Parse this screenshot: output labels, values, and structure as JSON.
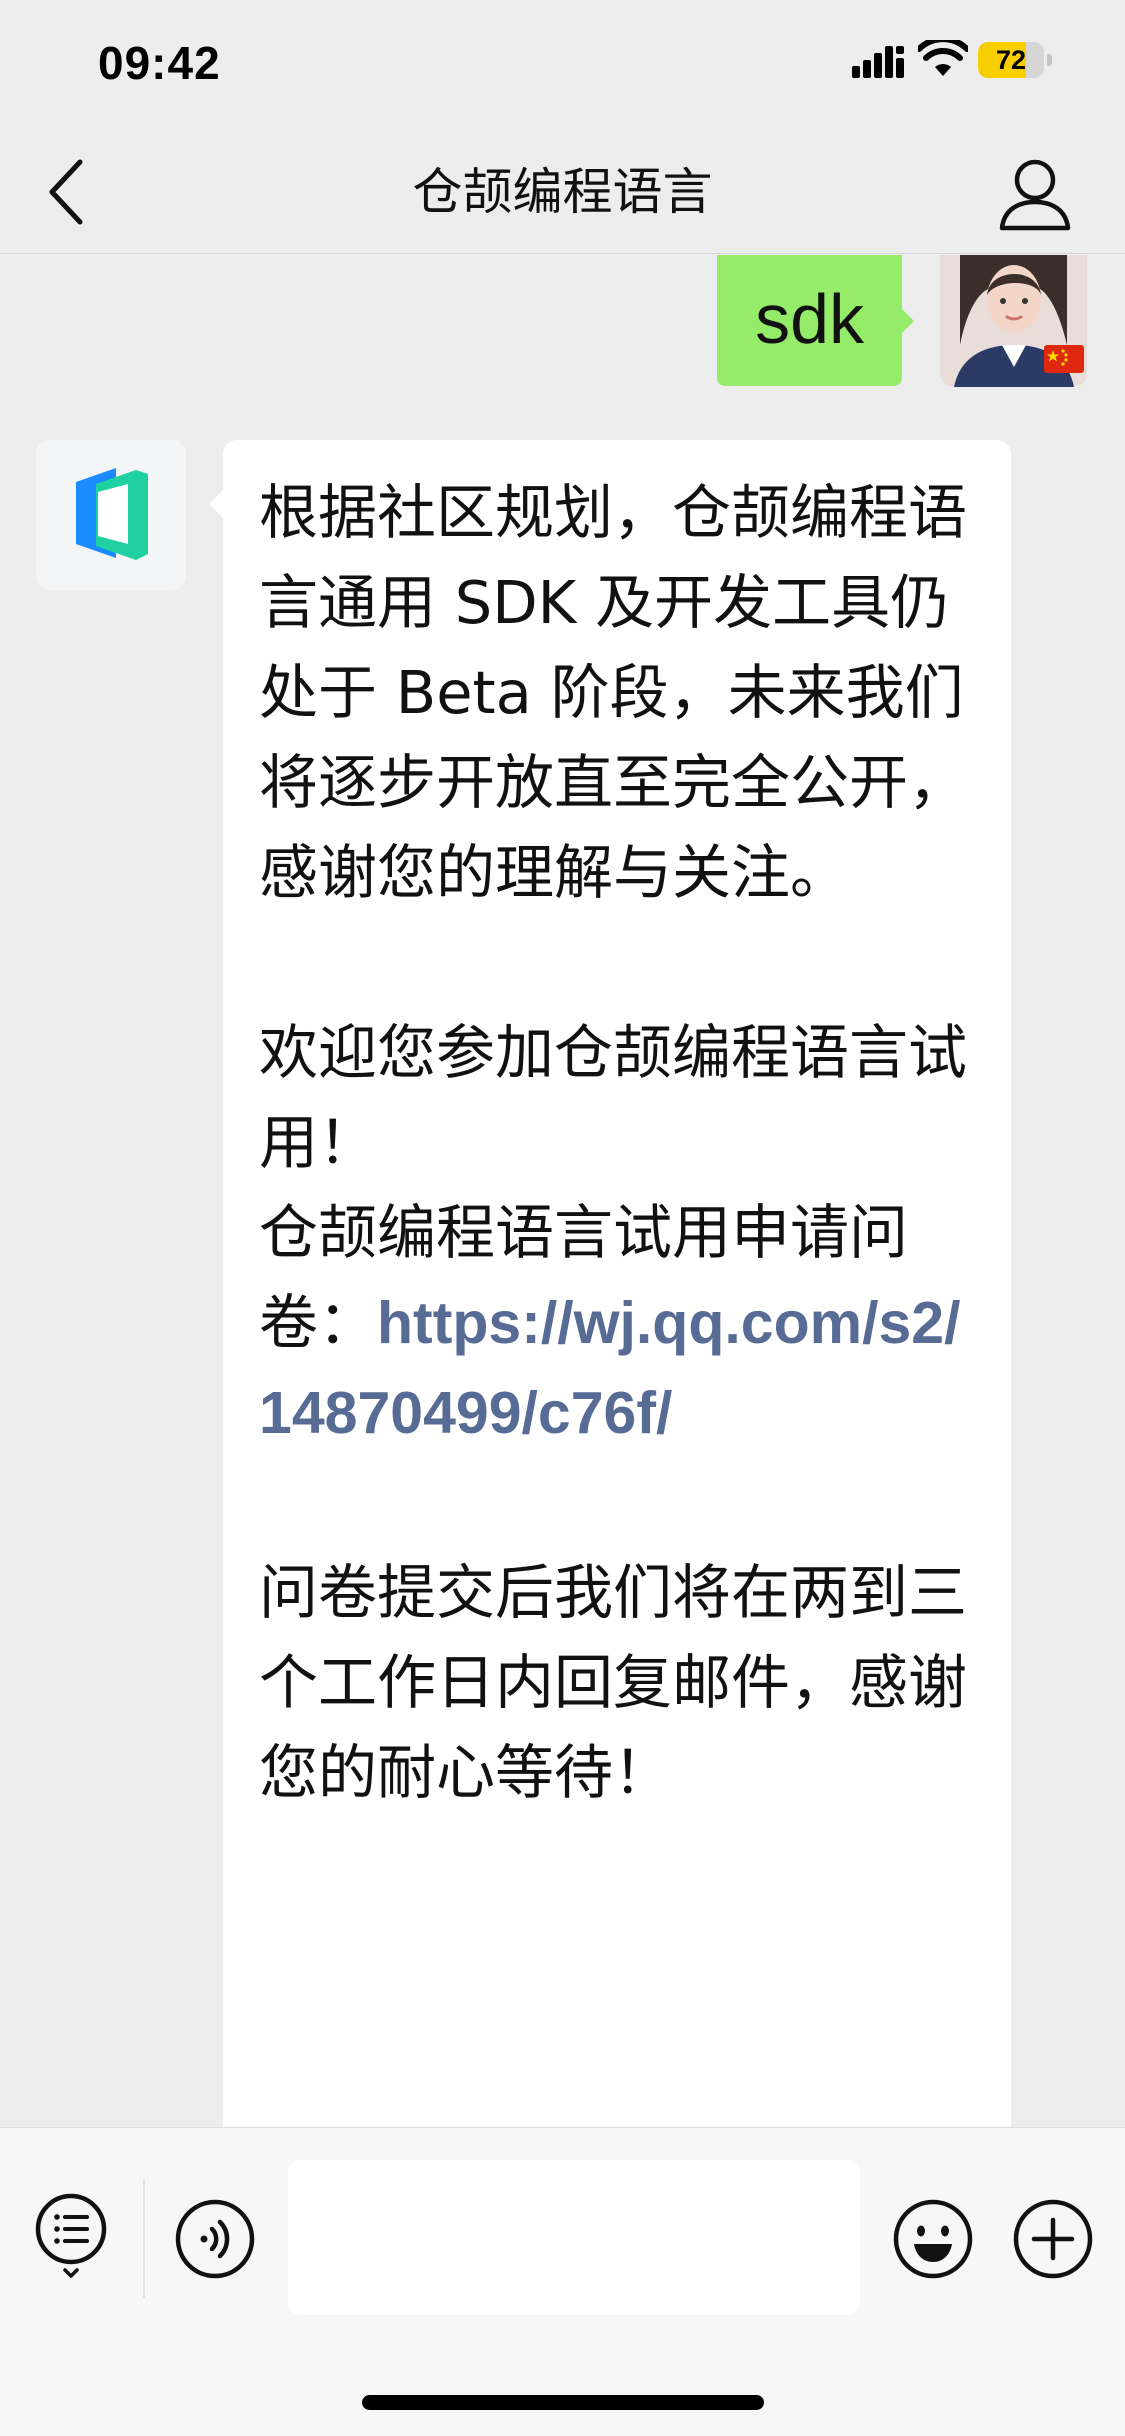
{
  "status_bar": {
    "time": "09:42",
    "battery_level": "72",
    "battery_fraction": 0.72,
    "icons": [
      "signal-icon",
      "wifi-icon",
      "battery-icon"
    ]
  },
  "header": {
    "title": "仓颉编程语言",
    "back_icon": "chevron-left-icon",
    "profile_icon": "person-icon"
  },
  "messages": [
    {
      "direction": "outgoing",
      "text": "sdk",
      "avatar": "user-avatar-with-china-flag"
    },
    {
      "direction": "incoming",
      "avatar": "cangjie-logo",
      "paragraphs": {
        "p1": "根据社区规划，仓颉编程语言通用 SDK 及开发工具仍处于 Beta 阶段，未来我们将逐步开放直至完全公开，感谢您的理解与关注。",
        "p2": "欢迎您参加仓颉编程语言试用！",
        "p3_label": "仓颉编程语言试用申请问卷：",
        "p3_link": "https://wj.qq.com/s2/14870499/c76f/",
        "p4": "问卷提交后我们将在两到三个工作日内回复邮件，感谢您的耐心等待！"
      }
    }
  ],
  "input_bar": {
    "icons": [
      "menu-list-icon",
      "voice-icon",
      "emoji-icon",
      "plus-icon"
    ],
    "input_value": ""
  },
  "colors": {
    "background": "#ededed",
    "outgoing_bubble": "#95ec69",
    "incoming_bubble": "#ffffff",
    "link": "#576b95",
    "battery": "#f7ce00",
    "logo_blue": "#1a8cff",
    "logo_green": "#1fd1a0"
  }
}
